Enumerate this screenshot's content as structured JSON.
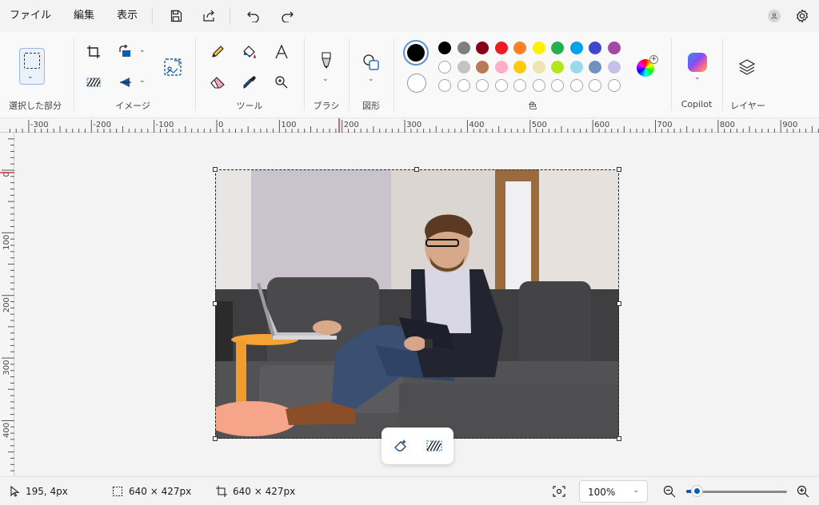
{
  "menubar": {
    "items": [
      "ファイル",
      "編集",
      "表示"
    ],
    "avatar_icon": "user-avatar-icon"
  },
  "ribbon": {
    "groups": {
      "selection": "選択した部分",
      "image": "イメージ",
      "tools": "ツール",
      "brushes": "ブラシ",
      "shapes": "図形",
      "colors": "色",
      "copilot": "Copilot",
      "layers": "レイヤー"
    },
    "palette": {
      "row1": [
        "#000000",
        "#7f7f7f",
        "#880015",
        "#ed1c24",
        "#ff7f27",
        "#fff200",
        "#22b14c",
        "#00a2e8",
        "#3f48cc",
        "#a349a4"
      ],
      "row2": [
        "#ffffff",
        "#c3c3c3",
        "#b97a57",
        "#ffaec9",
        "#ffc90e",
        "#efe4b0",
        "#b5e61d",
        "#99d9ea",
        "#7092be",
        "#c8bfe7"
      ],
      "row3_count": 10,
      "primary": "#000000",
      "secondary": "#ffffff"
    }
  },
  "ruler": {
    "h_labels": [
      "-300",
      "-200",
      "-100",
      "0",
      "100",
      "200",
      "300",
      "400",
      "500",
      "600",
      "700",
      "800",
      "900"
    ],
    "v_labels": [
      "0",
      "100",
      "200",
      "300",
      "400"
    ]
  },
  "status": {
    "cursor_pos": "195, 4px",
    "selection_size": "640 × 427px",
    "canvas_size": "640 × 427px",
    "zoom": "100%",
    "zoom_level": 0.1
  }
}
